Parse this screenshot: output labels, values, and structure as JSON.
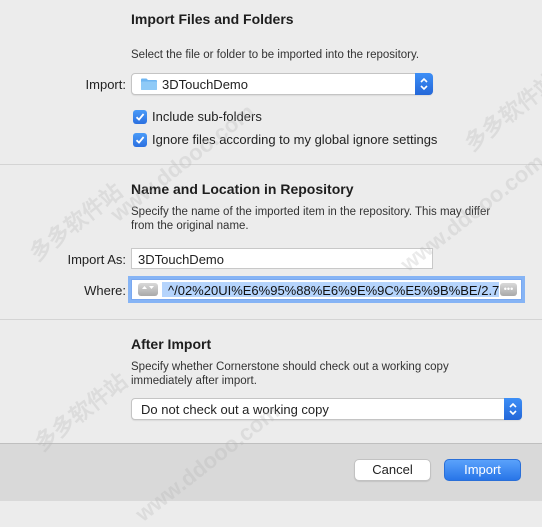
{
  "import_section": {
    "title": "Import Files and Folders",
    "description": "Select the file or folder to be imported into the repository.",
    "import_label": "Import:",
    "import_value": "3DTouchDemo",
    "include_subfolders_label": "Include sub-folders",
    "include_subfolders_checked": true,
    "ignore_files_label": "Ignore files according to my global ignore settings",
    "ignore_files_checked": true
  },
  "name_section": {
    "title": "Name and Location in Repository",
    "description_line1": "Specify the name of the imported item in the repository. This may differ",
    "description_line2": "from the original name.",
    "import_as_label": "Import As:",
    "import_as_value": "3DTouchDemo",
    "where_label": "Where:",
    "where_value": "^/02%20UI%E6%95%88%E6%9E%9C%E5%9B%BE/2.7"
  },
  "after_section": {
    "title": "After Import",
    "description_line1": "Specify whether Cornerstone should check out a working copy",
    "description_line2": "immediately after import.",
    "checkout_option": "Do not check out a working copy"
  },
  "footer": {
    "cancel_label": "Cancel",
    "import_label": "Import"
  },
  "watermarks": [
    "多多软件站",
    "www.ddooo.com",
    "多多软件站",
    "www.ddooo.com",
    "多多软件站",
    "www.ddooo.com"
  ],
  "colors": {
    "accent": "#2a72e6",
    "selection": "#b5d4fc",
    "background": "#ececec"
  }
}
